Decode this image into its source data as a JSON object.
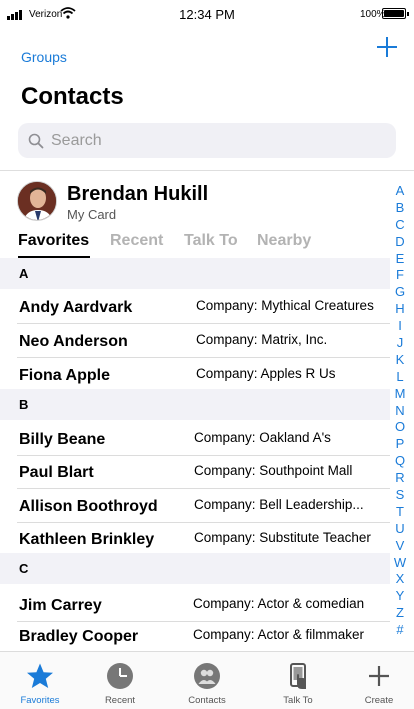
{
  "status_bar": {
    "carrier": "Verizon",
    "time": "12:34 PM",
    "battery": "100%",
    "battery_level": 1.0
  },
  "header": {
    "groups_label": "Groups",
    "title": "Contacts",
    "add_icon": "plus-icon"
  },
  "search": {
    "placeholder": "Search",
    "value": ""
  },
  "my_card": {
    "name": "Brendan Hukill",
    "label": "My Card"
  },
  "tabs": [
    {
      "label": "Favorites",
      "active": true
    },
    {
      "label": "Recent",
      "active": false
    },
    {
      "label": "Talk To",
      "active": false
    },
    {
      "label": "Nearby",
      "active": false
    }
  ],
  "sections": [
    {
      "letter": "A",
      "contacts": [
        {
          "name": "Andy Aardvark",
          "company": "Company: Mythical Creatures"
        },
        {
          "name": "Neo Anderson",
          "company": "Company: Matrix, Inc."
        },
        {
          "name": "Fiona Apple",
          "company": "Company: Apples R Us"
        }
      ]
    },
    {
      "letter": "B",
      "contacts": [
        {
          "name": "Billy Beane",
          "company": "Company: Oakland A's"
        },
        {
          "name": "Paul Blart",
          "company": "Company: Southpoint Mall"
        },
        {
          "name": "Allison Boothroyd",
          "company": "Company: Bell Leadership..."
        },
        {
          "name": "Kathleen Brinkley",
          "company": "Company: Substitute Teacher"
        }
      ]
    },
    {
      "letter": "C",
      "contacts": [
        {
          "name": "Jim Carrey",
          "company": "Company: Actor & comedian"
        },
        {
          "name": "Bradley Cooper",
          "company": "Company: Actor & filmmaker"
        }
      ]
    }
  ],
  "alphabet_index": [
    "A",
    "B",
    "C",
    "D",
    "E",
    "F",
    "G",
    "H",
    "I",
    "J",
    "K",
    "L",
    "M",
    "N",
    "O",
    "P",
    "Q",
    "R",
    "S",
    "T",
    "U",
    "V",
    "W",
    "X",
    "Y",
    "Z",
    "#"
  ],
  "tab_bar": [
    {
      "label": "Favorites",
      "icon": "star-icon",
      "active": true
    },
    {
      "label": "Recent",
      "icon": "clock-icon",
      "active": false
    },
    {
      "label": "Contacts",
      "icon": "people-icon",
      "active": false
    },
    {
      "label": "Talk To",
      "icon": "phone-touch-icon",
      "active": false
    },
    {
      "label": "Create",
      "icon": "plus-icon",
      "active": false
    }
  ],
  "colors": {
    "accent": "#1a7bd8",
    "section_bg": "#f2f2f7",
    "inactive_tab": "#b3b3b3"
  }
}
